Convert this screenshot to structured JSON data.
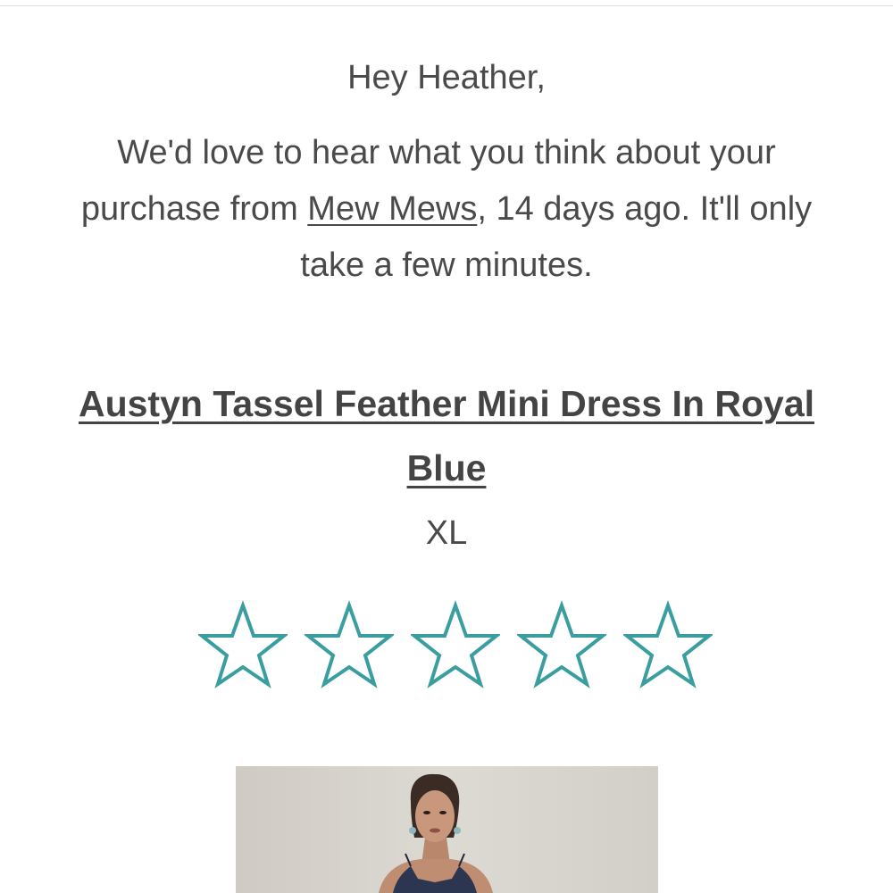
{
  "greeting": "Hey Heather,",
  "message": {
    "before_link": "We'd love to hear what you think about your purchase from ",
    "store_link": "Mew Mews",
    "after_link": ", 14 days ago. It'll only take a few minutes."
  },
  "product": {
    "title": "Austyn Tassel Feather Mini Dress In Royal Blue",
    "variant": "XL"
  },
  "rating": {
    "max_stars": 5,
    "selected": 0,
    "star_color": "#3a9ea0"
  },
  "colors": {
    "text": "#4a4a4a",
    "accent": "#3a9ea0"
  }
}
